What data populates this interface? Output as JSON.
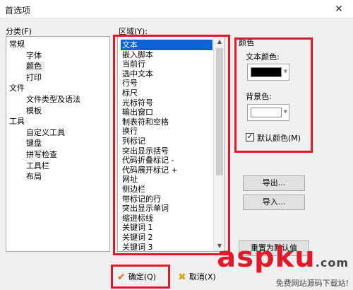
{
  "window": {
    "title": "首选项",
    "close_glyph": "✕"
  },
  "category": {
    "label": "分类(F)",
    "items": [
      "常规",
      "字体",
      "颜色",
      "打印",
      "文件",
      "文件类型及语法",
      "模板",
      "工具",
      "自定义工具",
      "键盘",
      "拼写检查",
      "工具栏",
      "布局"
    ],
    "selected": "颜色"
  },
  "area": {
    "label": "区域(Y):",
    "items": [
      "文本",
      "嵌入脚本",
      "当前行",
      "选中文本",
      "行号",
      "标尺",
      "光标符号",
      "输出窗口",
      "制表符和空格",
      "换行",
      "列标记",
      "突出显示括号",
      "代码折叠标记 -",
      "代码展开标记 +",
      "网址",
      "侧边栏",
      "带标记的行",
      "突出显示单词",
      "缩进标线",
      "关键词 1",
      "关键词 2",
      "关键词 3"
    ],
    "selected": "文本"
  },
  "color": {
    "group_label": "颜色",
    "text_color_label": "文本颜色:",
    "text_color_value": "#000000",
    "bg_color_label": "背景色:",
    "bg_color_value": "#ffffff",
    "default_checkbox_label": "默认颜色(M)",
    "default_checked": true
  },
  "buttons": {
    "export": "导出...",
    "import": "导入...",
    "reset": "重置为默认值",
    "ok": "确定(Q)",
    "cancel": "取消(X)"
  },
  "watermark": {
    "brand": "aspku",
    "suffix": ".com",
    "subtitle": "免费网站源码下载站!"
  },
  "colors": {
    "highlight": "#e0192b",
    "selection": "#0a64d6"
  }
}
